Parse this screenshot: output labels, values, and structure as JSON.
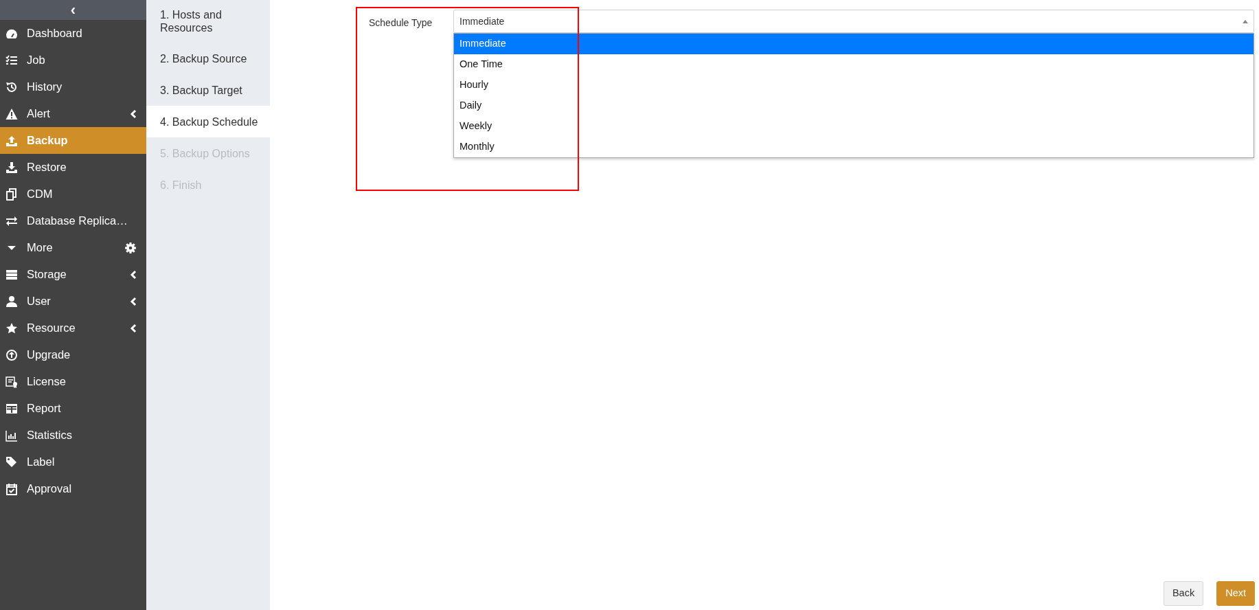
{
  "sidebar": {
    "collapse_toggle": "‹",
    "items": [
      {
        "label": "Dashboard",
        "selected": false,
        "submenu": false
      },
      {
        "label": "Job",
        "selected": false,
        "submenu": false
      },
      {
        "label": "History",
        "selected": false,
        "submenu": false
      },
      {
        "label": "Alert",
        "selected": false,
        "submenu": true
      },
      {
        "label": "Backup",
        "selected": true,
        "submenu": false
      },
      {
        "label": "Restore",
        "selected": false,
        "submenu": false
      },
      {
        "label": "CDM",
        "selected": false,
        "submenu": false
      },
      {
        "label": "Database Replica…",
        "selected": false,
        "submenu": false
      },
      {
        "label": "More",
        "selected": false,
        "submenu": false,
        "settings": true
      },
      {
        "label": "Storage",
        "selected": false,
        "submenu": true
      },
      {
        "label": "User",
        "selected": false,
        "submenu": true
      },
      {
        "label": "Resource",
        "selected": false,
        "submenu": true
      },
      {
        "label": "Upgrade",
        "selected": false,
        "submenu": false
      },
      {
        "label": "License",
        "selected": false,
        "submenu": false
      },
      {
        "label": "Report",
        "selected": false,
        "submenu": false
      },
      {
        "label": "Statistics",
        "selected": false,
        "submenu": false
      },
      {
        "label": "Label",
        "selected": false,
        "submenu": false
      },
      {
        "label": "Approval",
        "selected": false,
        "submenu": false
      }
    ]
  },
  "steps": [
    {
      "label": "1. Hosts and Resources",
      "selected": false,
      "disabled": false
    },
    {
      "label": "2. Backup Source",
      "selected": false,
      "disabled": false
    },
    {
      "label": "3. Backup Target",
      "selected": false,
      "disabled": false
    },
    {
      "label": "4. Backup Schedule",
      "selected": true,
      "disabled": false
    },
    {
      "label": "5. Backup Options",
      "selected": false,
      "disabled": true
    },
    {
      "label": "6. Finish",
      "selected": false,
      "disabled": true
    }
  ],
  "form": {
    "highlighted": true,
    "schedule_type": {
      "label": "Schedule Type",
      "value": "Immediate",
      "expanded": true,
      "options": [
        {
          "label": "Immediate",
          "selected": true
        },
        {
          "label": "One Time",
          "selected": false
        },
        {
          "label": "Hourly",
          "selected": false
        },
        {
          "label": "Daily",
          "selected": false
        },
        {
          "label": "Weekly",
          "selected": false
        },
        {
          "label": "Monthly",
          "selected": false
        }
      ]
    }
  },
  "buttons": [
    {
      "label": "Back",
      "kind": "secondary"
    },
    {
      "label": "Next",
      "kind": "primary"
    }
  ]
}
